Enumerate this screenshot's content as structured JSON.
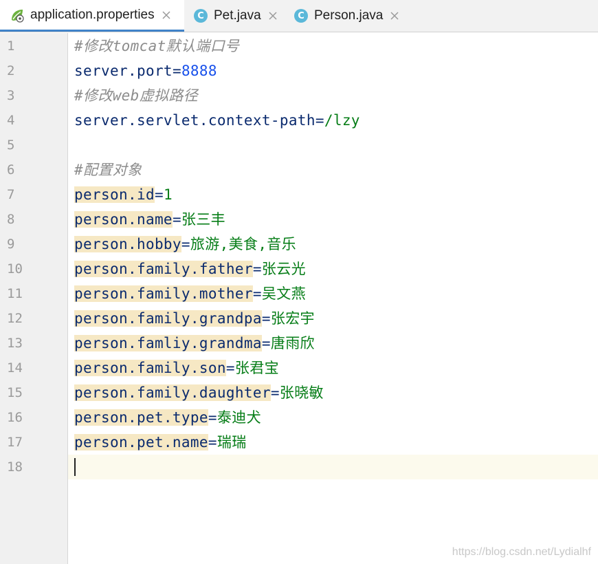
{
  "tabs": [
    {
      "label": "application.properties",
      "icon": "spring-leaf-icon",
      "active": true
    },
    {
      "label": "Pet.java",
      "icon": "class-c-icon",
      "active": false
    },
    {
      "label": "Person.java",
      "icon": "class-c-icon",
      "active": false
    }
  ],
  "class_icon_letter": "C",
  "editor": {
    "line_numbers": [
      "1",
      "2",
      "3",
      "4",
      "5",
      "6",
      "7",
      "8",
      "9",
      "10",
      "11",
      "12",
      "13",
      "14",
      "15",
      "16",
      "17",
      "18"
    ],
    "lines": [
      {
        "comment": "#修改tomcat默认端口号"
      },
      {
        "key": "server.port",
        "eq": "=",
        "value": "8888"
      },
      {
        "comment": "#修改web虚拟路径"
      },
      {
        "key": "server.servlet.context-path",
        "eq": "=",
        "value": "/lzy"
      },
      {},
      {
        "comment": "#配置对象"
      },
      {
        "key": "person.id",
        "eq": "=",
        "value": "1"
      },
      {
        "key": "person.name",
        "eq": "=",
        "value": "张三丰"
      },
      {
        "key": "person.hobby",
        "eq": "=",
        "value": "旅游,美食,音乐"
      },
      {
        "key": "person.family.father",
        "eq": "=",
        "value": "张云光"
      },
      {
        "key": "person.family.mother",
        "eq": "=",
        "value": "吴文燕"
      },
      {
        "key": "person.family.grandpa",
        "eq": "=",
        "value": "张宏宇"
      },
      {
        "key": "person.famliy.grandma",
        "eq": "=",
        "value": "唐雨欣"
      },
      {
        "key": "person.family.son",
        "eq": "=",
        "value": "张君宝"
      },
      {
        "key": "person.family.daughter",
        "eq": "=",
        "value": "张晓敏"
      },
      {
        "key": "person.pet.type",
        "eq": "=",
        "value": "泰迪犬"
      },
      {
        "key": "person.pet.name",
        "eq": "=",
        "value": "瑞瑞"
      },
      {}
    ],
    "current_line": 18
  },
  "watermark": "https://blog.csdn.net/Lydialhf",
  "colors": {
    "key": "#0a2a6e",
    "number": "#1750eb",
    "string_value": "#067d17",
    "comment": "#8c8c8c",
    "key_highlight": "#f6e8c4",
    "active_tab_underline": "#4083c9",
    "current_line": "#fcfaed"
  }
}
